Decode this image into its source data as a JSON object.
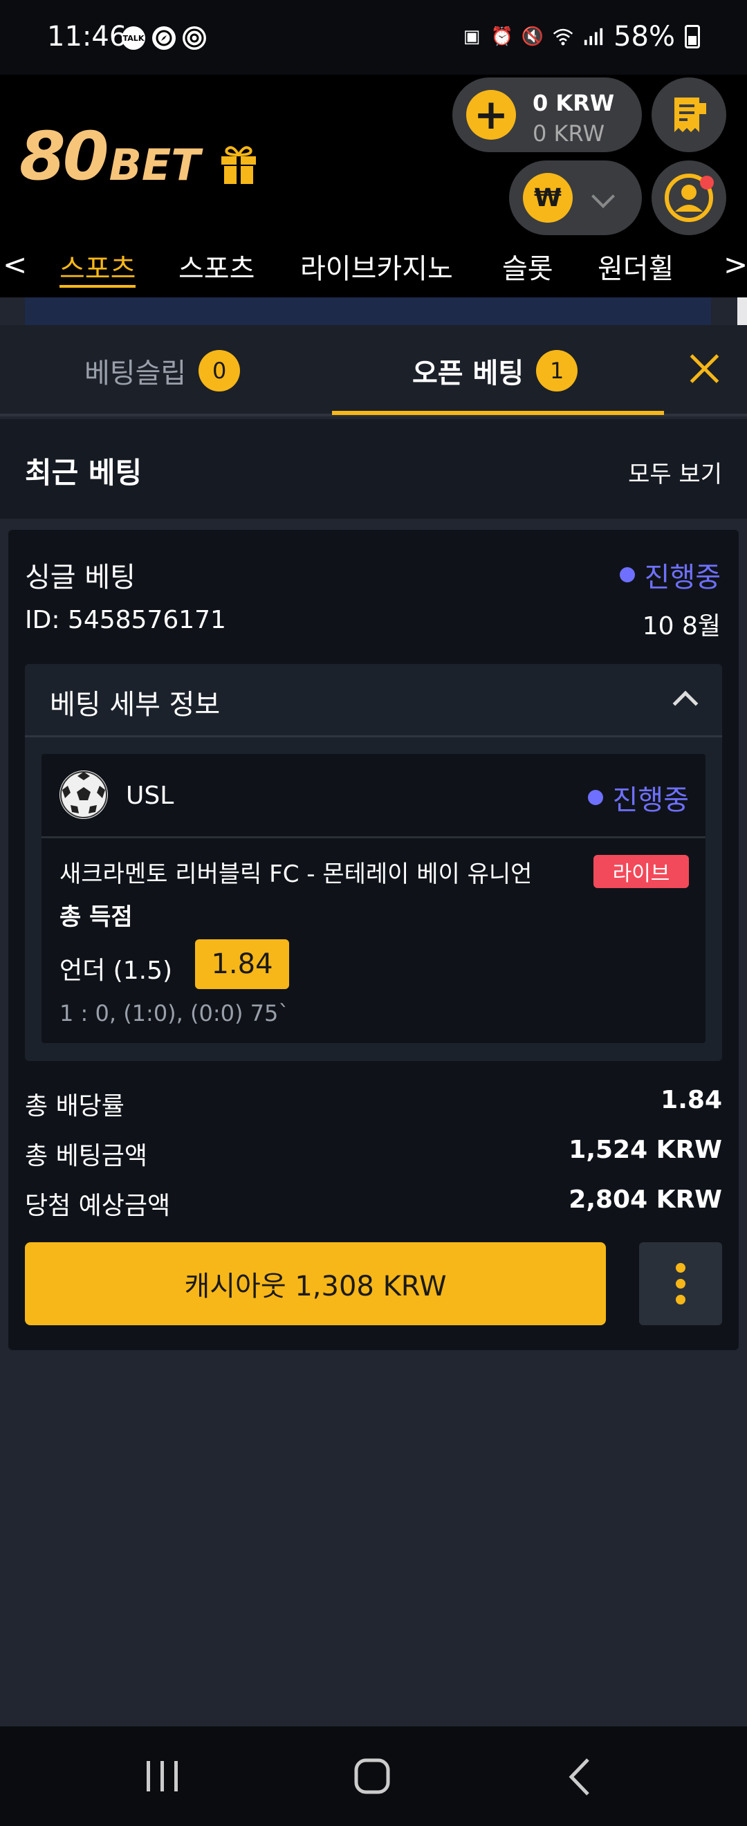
{
  "status_bar": {
    "time": "11:46",
    "battery": "58%",
    "left_icons": [
      "talk-icon",
      "compass-icon",
      "chrome-icon"
    ],
    "right_icons": [
      "battery-saver-icon",
      "alarm-icon",
      "mute-icon",
      "wifi-icon",
      "signal-icon"
    ]
  },
  "header": {
    "logo_number": "80",
    "logo_text": "BET",
    "balance_primary": "0 KRW",
    "balance_secondary": "0 KRW",
    "currency_symbol": "₩"
  },
  "nav": {
    "items": [
      "스포츠",
      "스포츠",
      "라이브카지노",
      "슬롯",
      "원더휠"
    ],
    "active_index": 0,
    "prev": "<",
    "next": ">"
  },
  "tabs": {
    "betslip_label": "베팅슬립",
    "betslip_count": "0",
    "open_bets_label": "오픈 베팅",
    "open_bets_count": "1"
  },
  "recent": {
    "title": "최근 베팅",
    "see_all": "모두 보기"
  },
  "bet": {
    "type": "싱글 베팅",
    "status": "진행중",
    "id": "ID: 5458576171",
    "date": "10 8월",
    "details_title": "베팅 세부 정보",
    "league": "USL",
    "match_status": "진행중",
    "match_name": "새크라멘토 리버블릭 FC - 몬테레이 베이 유니언",
    "live_label": "라이브",
    "market": "총 득점",
    "selection": "언더 (1.5)",
    "odds": "1.84",
    "score": "1 : 0, (1:0), (0:0) 75`",
    "summary": [
      {
        "label": "총 배당률",
        "value": "1.84"
      },
      {
        "label": "총 베팅금액",
        "value": "1,524 KRW"
      },
      {
        "label": "당첨 예상금액",
        "value": "2,804 KRW"
      }
    ],
    "cashout_label": "캐시아웃 1,308 KRW"
  },
  "colors": {
    "accent": "#f7b718",
    "status": "#6f70ff",
    "live": "#f24a5a",
    "logo": "#f6c57a"
  }
}
